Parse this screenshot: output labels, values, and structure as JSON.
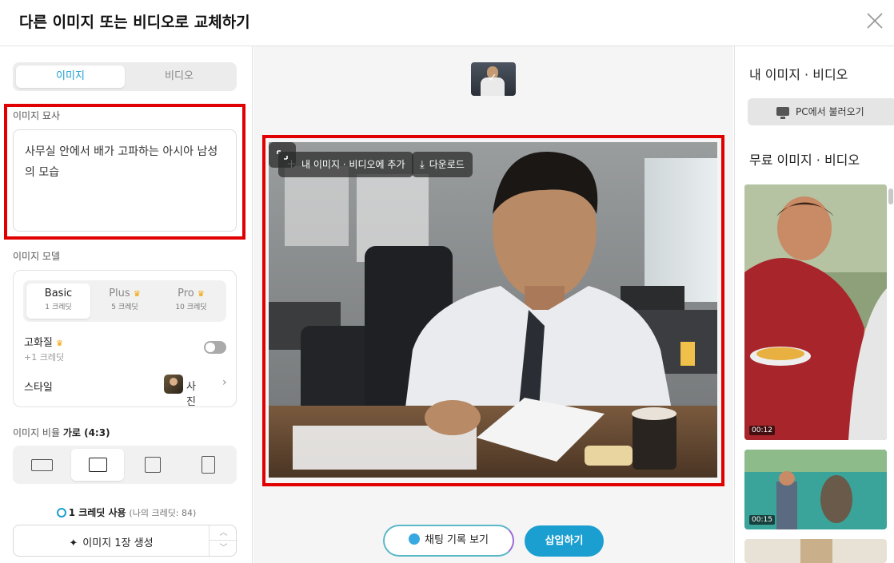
{
  "header": {
    "title": "다른 이미지 또는 비디오로 교체하기"
  },
  "left": {
    "tabs": [
      {
        "label": "이미지",
        "active": true
      },
      {
        "label": "비디오",
        "active": false
      }
    ],
    "prompt_label": "이미지 묘사",
    "prompt_value": "사무실 안에서 배가 고파하는 아시아 남성의 모습",
    "model_label": "이미지 모델",
    "models": [
      {
        "name": "Basic",
        "credit": "1 크레딧",
        "premium": false,
        "active": true
      },
      {
        "name": "Plus",
        "credit": "5 크레딧",
        "premium": true,
        "active": false
      },
      {
        "name": "Pro",
        "credit": "10 크레딧",
        "premium": true,
        "active": false
      }
    ],
    "high_quality_label": "고화질",
    "high_quality_sub": "+1 크레딧",
    "high_quality_enabled": false,
    "style_label": "스타일",
    "style_value": "사진",
    "ratio_label": "이미지 비율",
    "ratio_value": "가로 (4:3)",
    "credit_use": "1 크레딧 사용",
    "credit_mine": "(나의 크레딧: 84)",
    "generate_label": "이미지 1장 생성"
  },
  "center": {
    "add_label": "내 이미지 · 비디오에 추가",
    "download_label": "다운로드",
    "chat_history_label": "채팅 기록 보기",
    "insert_label": "삽입하기"
  },
  "right": {
    "my_media_title": "내 이미지 · 비디오",
    "pc_upload_label": "PC에서 불러오기",
    "free_media_title": "무료 이미지 · 비디오",
    "videos": [
      {
        "duration": "00:12"
      },
      {
        "duration": "00:15"
      }
    ]
  },
  "colors": {
    "accent": "#1a9fd0",
    "highlight_box": "#e00000",
    "premium_crown": "#f5a000"
  }
}
